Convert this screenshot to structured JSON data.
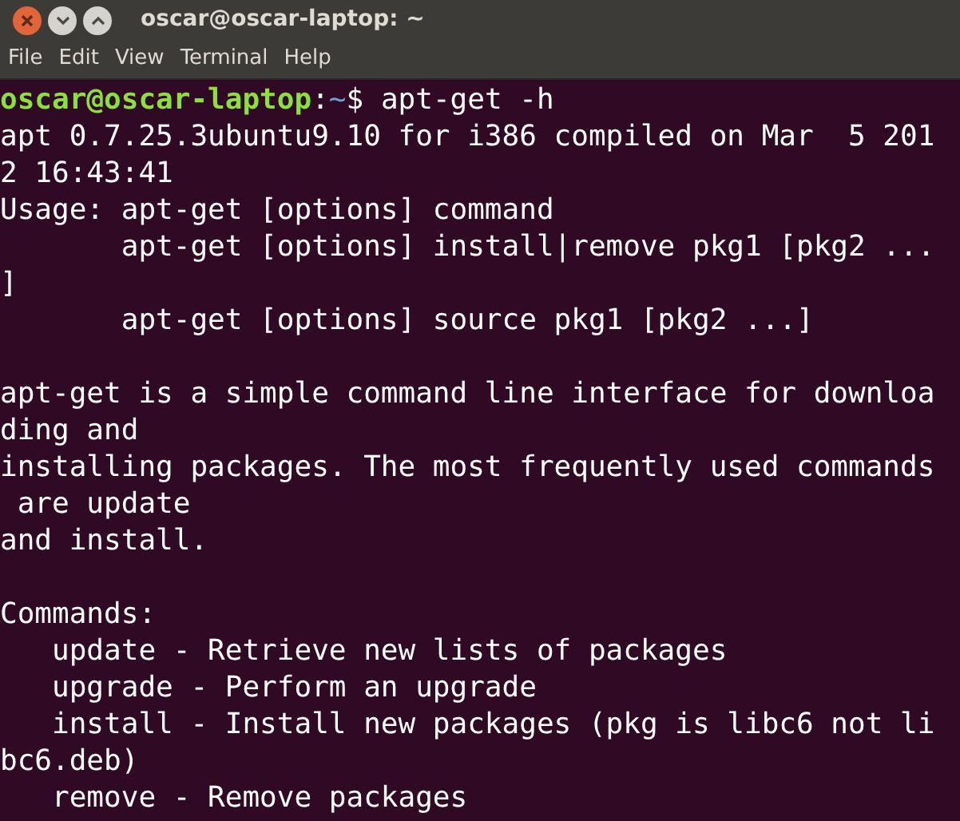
{
  "window": {
    "title": "oscar@oscar-laptop: ~"
  },
  "menu": [
    "File",
    "Edit",
    "View",
    "Terminal",
    "Help"
  ],
  "terminal": {
    "lines": [
      {
        "kind": "prompt",
        "user": "oscar@oscar-laptop",
        "sep": ":",
        "path": "~",
        "command": "$ apt-get -h"
      },
      {
        "kind": "text",
        "text": "apt 0.7.25.3ubuntu9.10 for i386 compiled on Mar  5 201"
      },
      {
        "kind": "text",
        "text": "2 16:43:41"
      },
      {
        "kind": "text",
        "text": "Usage: apt-get [options] command"
      },
      {
        "kind": "text",
        "text": "       apt-get [options] install|remove pkg1 [pkg2 ..."
      },
      {
        "kind": "text",
        "text": "]"
      },
      {
        "kind": "text",
        "text": "       apt-get [options] source pkg1 [pkg2 ...]"
      },
      {
        "kind": "blank"
      },
      {
        "kind": "text",
        "text": "apt-get is a simple command line interface for downloa"
      },
      {
        "kind": "text",
        "text": "ding and"
      },
      {
        "kind": "text",
        "text": "installing packages. The most frequently used commands"
      },
      {
        "kind": "text",
        "text": " are update"
      },
      {
        "kind": "text",
        "text": "and install."
      },
      {
        "kind": "blank"
      },
      {
        "kind": "text",
        "text": "Commands:"
      },
      {
        "kind": "text",
        "text": "   update - Retrieve new lists of packages"
      },
      {
        "kind": "text",
        "text": "   upgrade - Perform an upgrade"
      },
      {
        "kind": "text",
        "text": "   install - Install new packages (pkg is libc6 not li"
      },
      {
        "kind": "text",
        "text": "bc6.deb)"
      },
      {
        "kind": "text",
        "text": "   remove - Remove packages"
      }
    ]
  }
}
